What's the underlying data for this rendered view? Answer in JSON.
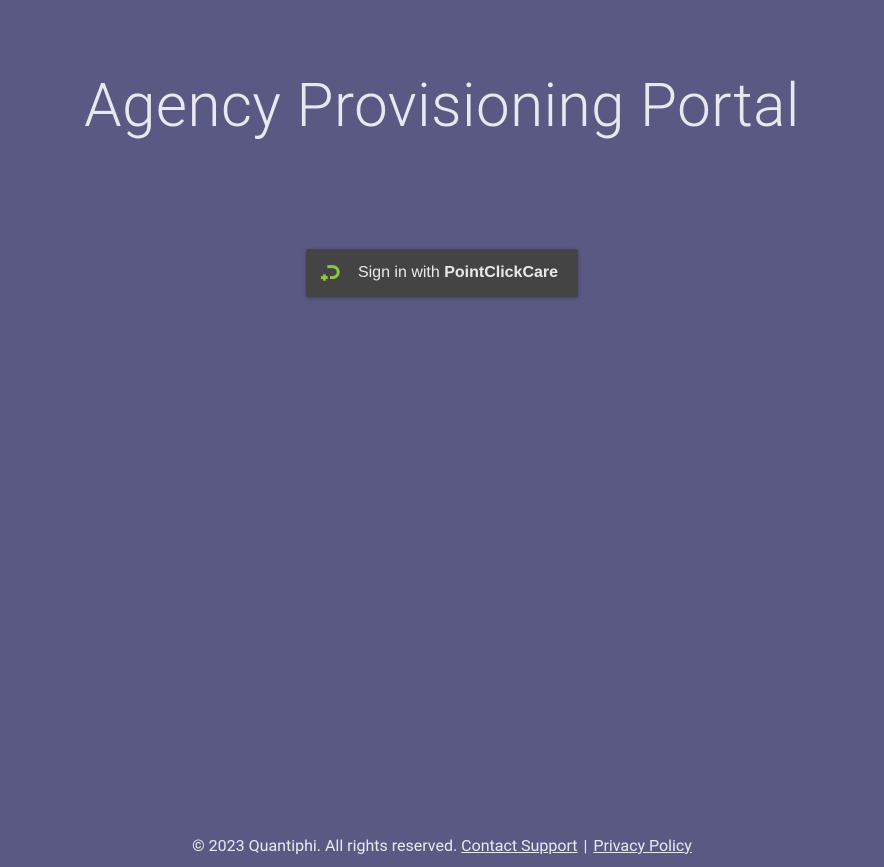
{
  "header": {
    "title": "Agency Provisioning Portal"
  },
  "auth": {
    "signin_prefix": "Sign in with ",
    "signin_brand": "PointClickCare"
  },
  "footer": {
    "copyright": "© 2023 Quantiphi. All rights reserved. ",
    "contact_label": "Contact Support",
    "separator": " | ",
    "privacy_label": "Privacy Policy"
  },
  "colors": {
    "background": "#5a5984",
    "button_bg": "#444444",
    "text_light": "#e8e8ef",
    "accent_green": "#8fc63f"
  }
}
